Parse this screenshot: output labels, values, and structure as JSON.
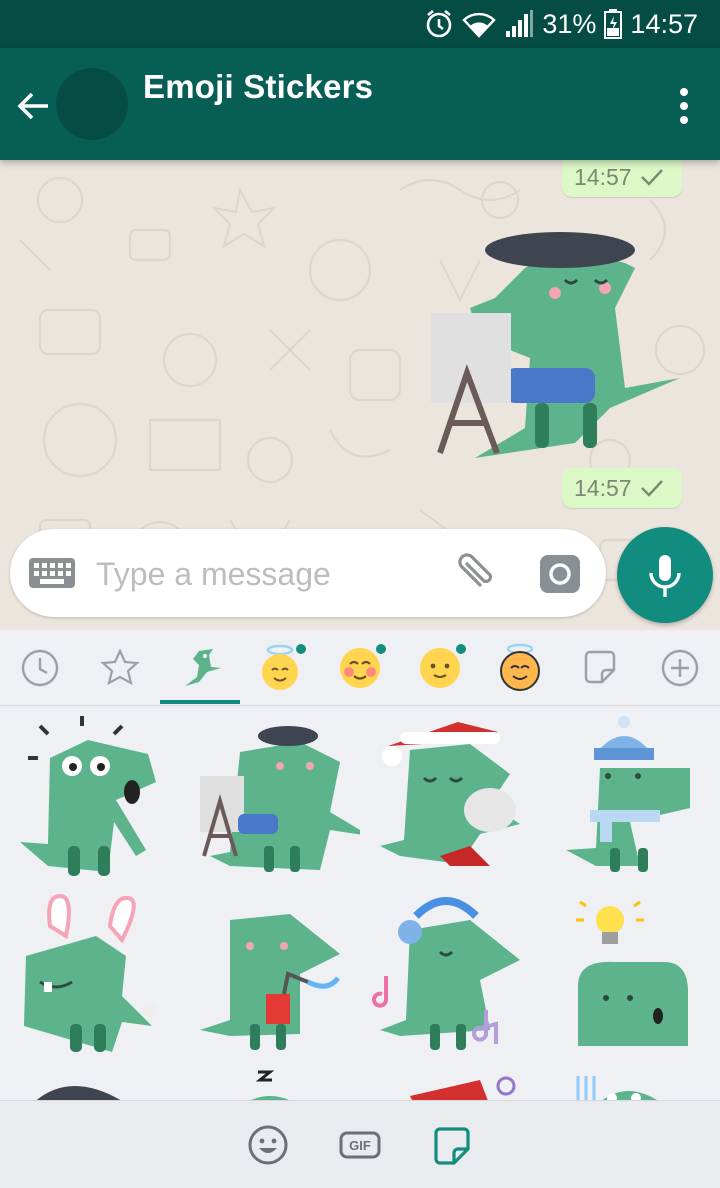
{
  "status_bar": {
    "battery": "31%",
    "time": "14:57"
  },
  "header": {
    "title": "Emoji Stickers"
  },
  "messages": [
    {
      "type": "time",
      "time": "14:57"
    },
    {
      "type": "sticker",
      "sticker": "dino-artist"
    },
    {
      "type": "time",
      "time": "14:57"
    }
  ],
  "composer": {
    "placeholder": "Type a message"
  },
  "tray_tabs": [
    "recent-icon",
    "favorites-icon",
    "dino-pack-tab",
    "angel-emoji-pack-tab",
    "blush-emoji-pack-tab",
    "smile-emoji-pack-tab",
    "halo-emoji-pack-tab",
    "new-sticker-pack-icon",
    "add-pack-icon"
  ],
  "stickers": [
    "dino-surprised",
    "dino-artist",
    "dino-santa",
    "dino-beanie",
    "dino-bunny-ears",
    "dino-drink",
    "dino-headphones",
    "dino-idea",
    "dino-ninja",
    "dino-sleepy",
    "dino-gift",
    "dino-cold"
  ],
  "bottom_tabs": [
    "emoji-icon",
    "gif-icon",
    "sticker-icon"
  ],
  "colors": {
    "primary": "#075e54",
    "accent": "#128c7e",
    "bubble": "#dcf8c6",
    "dino": "#5cb38c"
  }
}
